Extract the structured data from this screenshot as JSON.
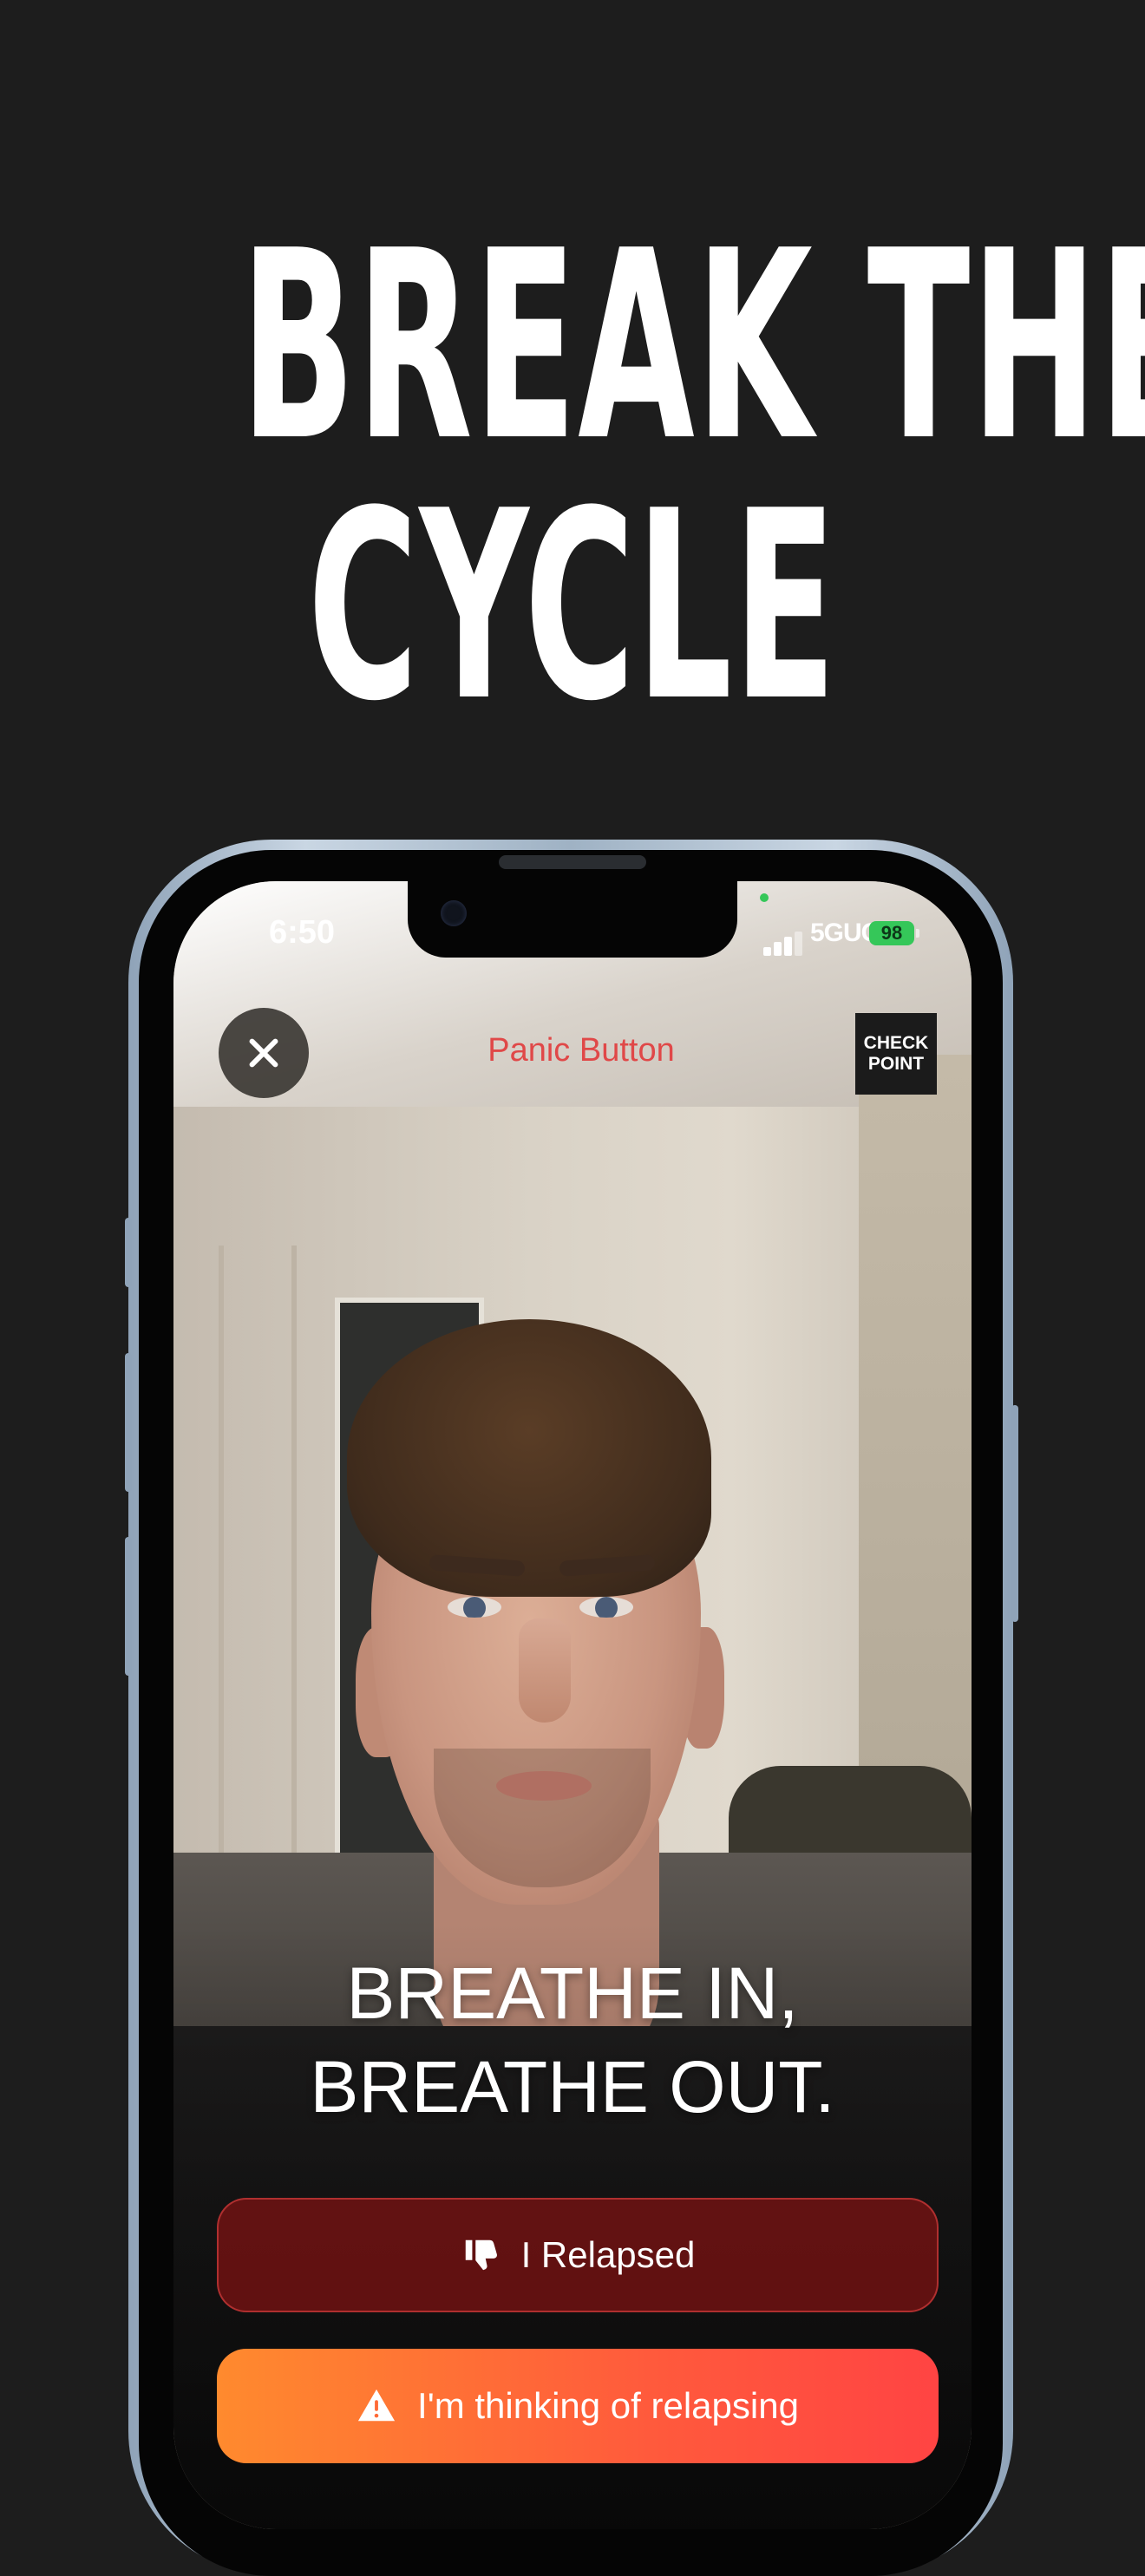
{
  "headline": {
    "line1": "BREAK THE",
    "line2": "CYCLE"
  },
  "status_bar": {
    "time": "6:50",
    "network": "5GUC",
    "battery": "98"
  },
  "header": {
    "title": "Panic Button",
    "logo_line1": "CHECK",
    "logo_line2": "POINT"
  },
  "prompt": {
    "line1": "BREATHE IN,",
    "line2": "BREATHE OUT."
  },
  "buttons": {
    "relapsed": "I Relapsed",
    "thinking": "I'm thinking of relapsing"
  },
  "icons": {
    "close": "close-icon",
    "relapsed": "thumbs-down-icon",
    "thinking": "warning-triangle-icon"
  },
  "colors": {
    "background": "#1d1d1d",
    "panic_title": "#e04848",
    "relapsed_button": "#781212",
    "thinking_gradient_start": "#ff8a2e",
    "thinking_gradient_end": "#ff4443",
    "battery": "#35c759"
  }
}
